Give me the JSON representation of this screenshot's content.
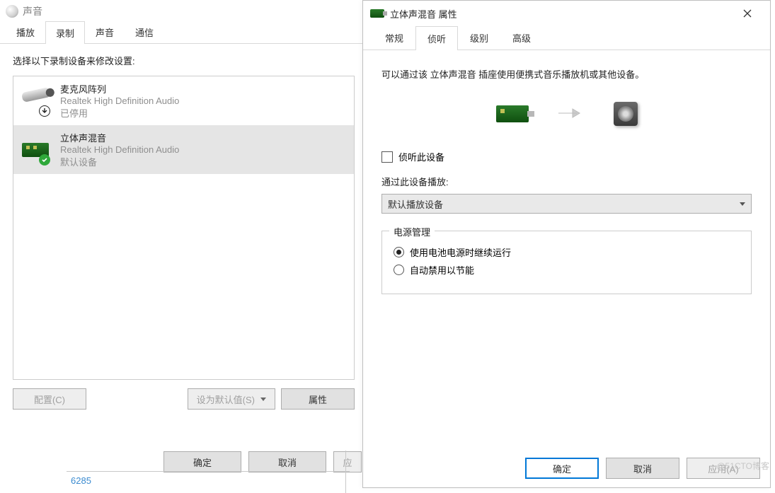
{
  "sound_window": {
    "title": "声音",
    "tabs": [
      "播放",
      "录制",
      "声音",
      "通信"
    ],
    "active_tab_index": 1,
    "instruction": "选择以下录制设备来修改设置:",
    "devices": [
      {
        "name": "麦克风阵列",
        "desc": "Realtek High Definition Audio",
        "status": "已停用",
        "selected": false,
        "icon": "mic",
        "badge": "down"
      },
      {
        "name": "立体声混音",
        "desc": "Realtek High Definition Audio",
        "status": "默认设备",
        "selected": true,
        "icon": "pcb",
        "badge": "ok"
      }
    ],
    "configure_btn": "配置(C)",
    "set_default_btn": "设为默认值(S)",
    "properties_btn": "属性",
    "ok_btn": "确定",
    "cancel_btn": "取消",
    "apply_btn": "应"
  },
  "props_window": {
    "title": "立体声混音 属性",
    "tabs": [
      "常规",
      "侦听",
      "级别",
      "高级"
    ],
    "active_tab_index": 1,
    "hint": "可以通过该 立体声混音 插座使用便携式音乐播放机或其他设备。",
    "listen_checkbox_label": "侦听此设备",
    "listen_checked": false,
    "play_through_label": "通过此设备播放:",
    "play_through_select": "默认播放设备",
    "fieldset_legend": "电源管理",
    "radio_options": [
      {
        "label": "使用电池电源时继续运行",
        "checked": true
      },
      {
        "label": "自动禁用以节能",
        "checked": false
      }
    ],
    "ok_btn": "确定",
    "cancel_btn": "取消",
    "apply_btn": "应用(A)"
  },
  "watermark": "@51CTO博客",
  "stray_number": "6285"
}
